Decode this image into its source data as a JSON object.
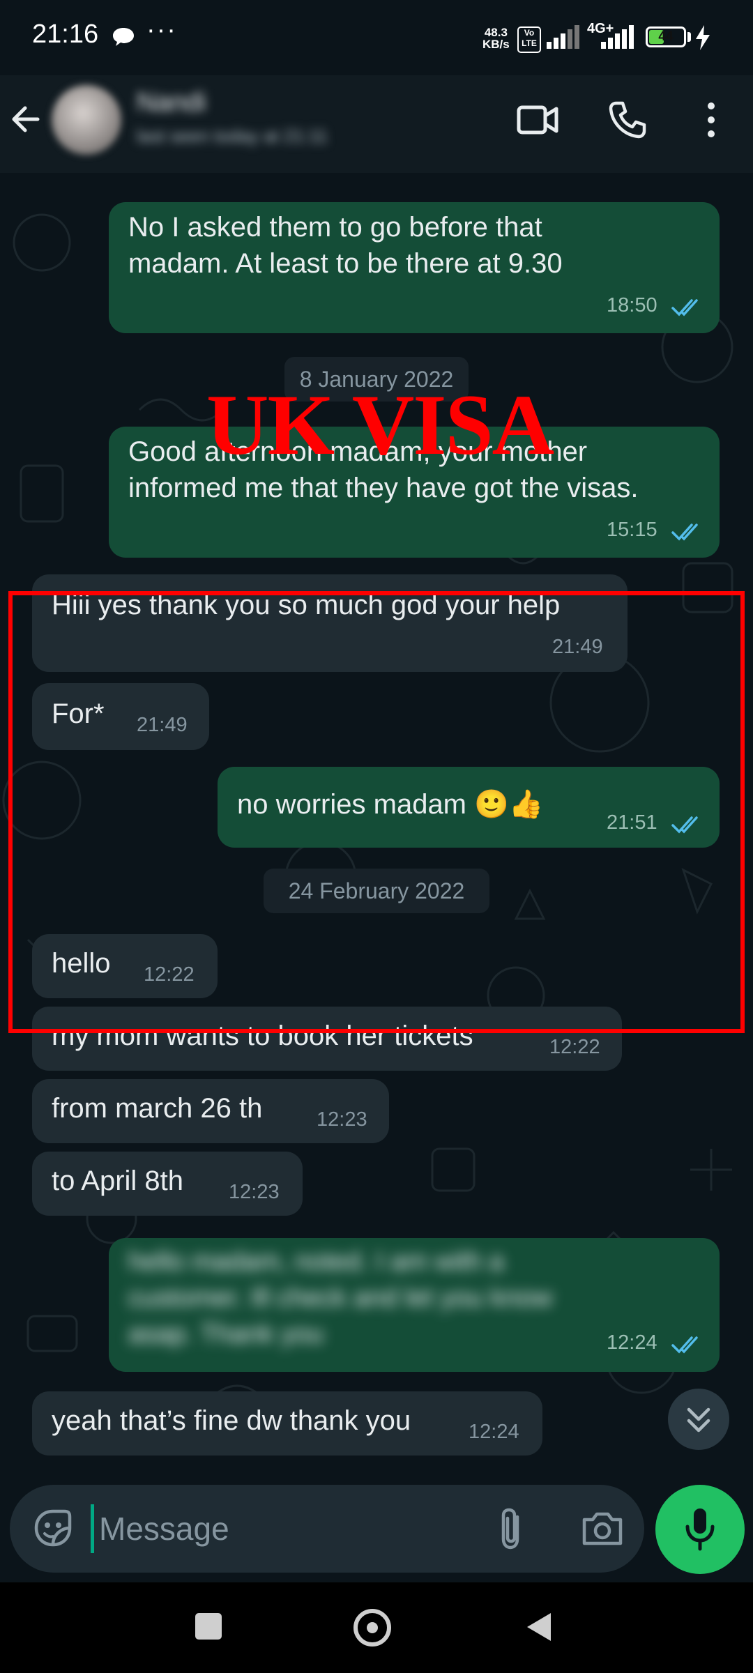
{
  "status_bar": {
    "time": "21:16",
    "more": "···",
    "speed_value": "48.3",
    "speed_unit": "KB/s",
    "volte": "Vo LTE",
    "network": "4G+",
    "battery": "44",
    "battery_level": 0.44
  },
  "header": {
    "contact_name": "Nandi",
    "contact_status": "last seen today at 21:11"
  },
  "messages": [
    {
      "direction": "out",
      "text": "No I asked them to go before that\nmadam. At least to be there at 9.30",
      "time": "18:50",
      "status": "read"
    },
    {
      "direction": "date",
      "text": "8 January 2022"
    },
    {
      "direction": "out",
      "text": "Good afternoon madam, your mother\ninformed me that they have got the visas.",
      "time": "15:15",
      "status": "read"
    },
    {
      "direction": "in",
      "text": "Hiii yes thank you so much god your help",
      "time": "21:49"
    },
    {
      "direction": "in",
      "text": "For*",
      "time": "21:49"
    },
    {
      "direction": "out",
      "text": "no worries madam 🙂👍",
      "time": "21:51",
      "status": "read"
    },
    {
      "direction": "date",
      "text": "24 February 2022"
    },
    {
      "direction": "in",
      "text": "hello",
      "time": "12:22"
    },
    {
      "direction": "in",
      "text": "my mom wants to book her tickets",
      "time": "12:22"
    },
    {
      "direction": "in",
      "text": "from march 26 th",
      "time": "12:23"
    },
    {
      "direction": "in",
      "text": "to April 8th",
      "time": "12:23"
    },
    {
      "direction": "out",
      "text": "hello madam, noted. I am with a\ncustomer. Ill check and let you know\nasap. Thank you",
      "time": "12:24",
      "status": "read",
      "blurred": true
    },
    {
      "direction": "in",
      "text": "yeah that’s fine dw thank you",
      "time": "12:24"
    }
  ],
  "overlay": {
    "title": "UK VISA",
    "highlight_color": "#ff0000"
  },
  "composer": {
    "placeholder": "Message"
  },
  "colors": {
    "background": "#0b141a",
    "header": "#111b21",
    "bubble_out": "#144d37",
    "bubble_in": "#202c33",
    "read_tick": "#53bdeb",
    "mic_button": "#21c063"
  },
  "icons": [
    "back-arrow-icon",
    "video-call-icon",
    "voice-call-icon",
    "more-vert-icon",
    "emoji-icon",
    "paperclip-icon",
    "camera-icon",
    "microphone-icon",
    "scroll-down-icon"
  ]
}
